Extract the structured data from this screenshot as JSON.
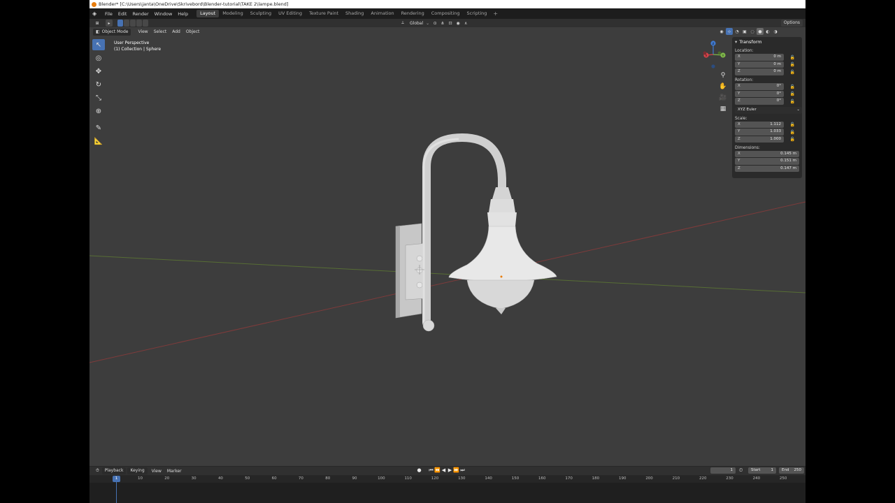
{
  "window": {
    "title": "Blender* [C:\\Users\\janta\\OneDrive\\Skrivebord\\Blender-tutorial\\TAKE 2\\lampe.blend]"
  },
  "menubar": {
    "menus": [
      "File",
      "Edit",
      "Render",
      "Window",
      "Help"
    ],
    "workspaces": [
      "Layout",
      "Modeling",
      "Sculpting",
      "UV Editing",
      "Texture Paint",
      "Shading",
      "Animation",
      "Rendering",
      "Compositing",
      "Scripting"
    ],
    "active_workspace": "Layout",
    "add_label": "+"
  },
  "toolheader": {
    "orientation": "Global",
    "options_label": "Options"
  },
  "viewport": {
    "mode": "Object Mode",
    "menus": [
      "View",
      "Select",
      "Add",
      "Object"
    ],
    "view_name": "User Perspective",
    "collection": "(1) Collection | Sphere",
    "accent": "#4772b3",
    "x_axis_color": "#8a3a3a",
    "y_axis_color": "#5a7a2a"
  },
  "gizmo": {
    "x": "X",
    "y": "Y",
    "z": "Z"
  },
  "npanel": {
    "title": "Transform",
    "location_label": "Location:",
    "location": [
      {
        "axis": "X",
        "value": "0 m"
      },
      {
        "axis": "Y",
        "value": "0 m"
      },
      {
        "axis": "Z",
        "value": "0 m"
      }
    ],
    "rotation_label": "Rotation:",
    "rotation": [
      {
        "axis": "X",
        "value": "0°"
      },
      {
        "axis": "Y",
        "value": "0°"
      },
      {
        "axis": "Z",
        "value": "0°"
      }
    ],
    "rotation_mode": "XYZ Euler",
    "scale_label": "Scale:",
    "scale": [
      {
        "axis": "X",
        "value": "1.112"
      },
      {
        "axis": "Y",
        "value": "1.033"
      },
      {
        "axis": "Z",
        "value": "1.000"
      }
    ],
    "dimensions_label": "Dimensions:",
    "dimensions": [
      {
        "axis": "X",
        "value": "0.145 m"
      },
      {
        "axis": "Y",
        "value": "0.151 m"
      },
      {
        "axis": "Z",
        "value": "0.147 m"
      }
    ]
  },
  "timeline": {
    "menus": [
      "Playback",
      "Keying",
      "View",
      "Marker"
    ],
    "current_frame": "1",
    "start_label": "Start",
    "start_value": "1",
    "end_label": "End",
    "end_value": "250",
    "ruler_marks": [
      "1",
      "10",
      "20",
      "30",
      "40",
      "50",
      "60",
      "70",
      "80",
      "90",
      "100",
      "110",
      "120",
      "130",
      "140",
      "150",
      "160",
      "170",
      "180",
      "190",
      "200",
      "210",
      "220",
      "230",
      "240",
      "250"
    ]
  }
}
